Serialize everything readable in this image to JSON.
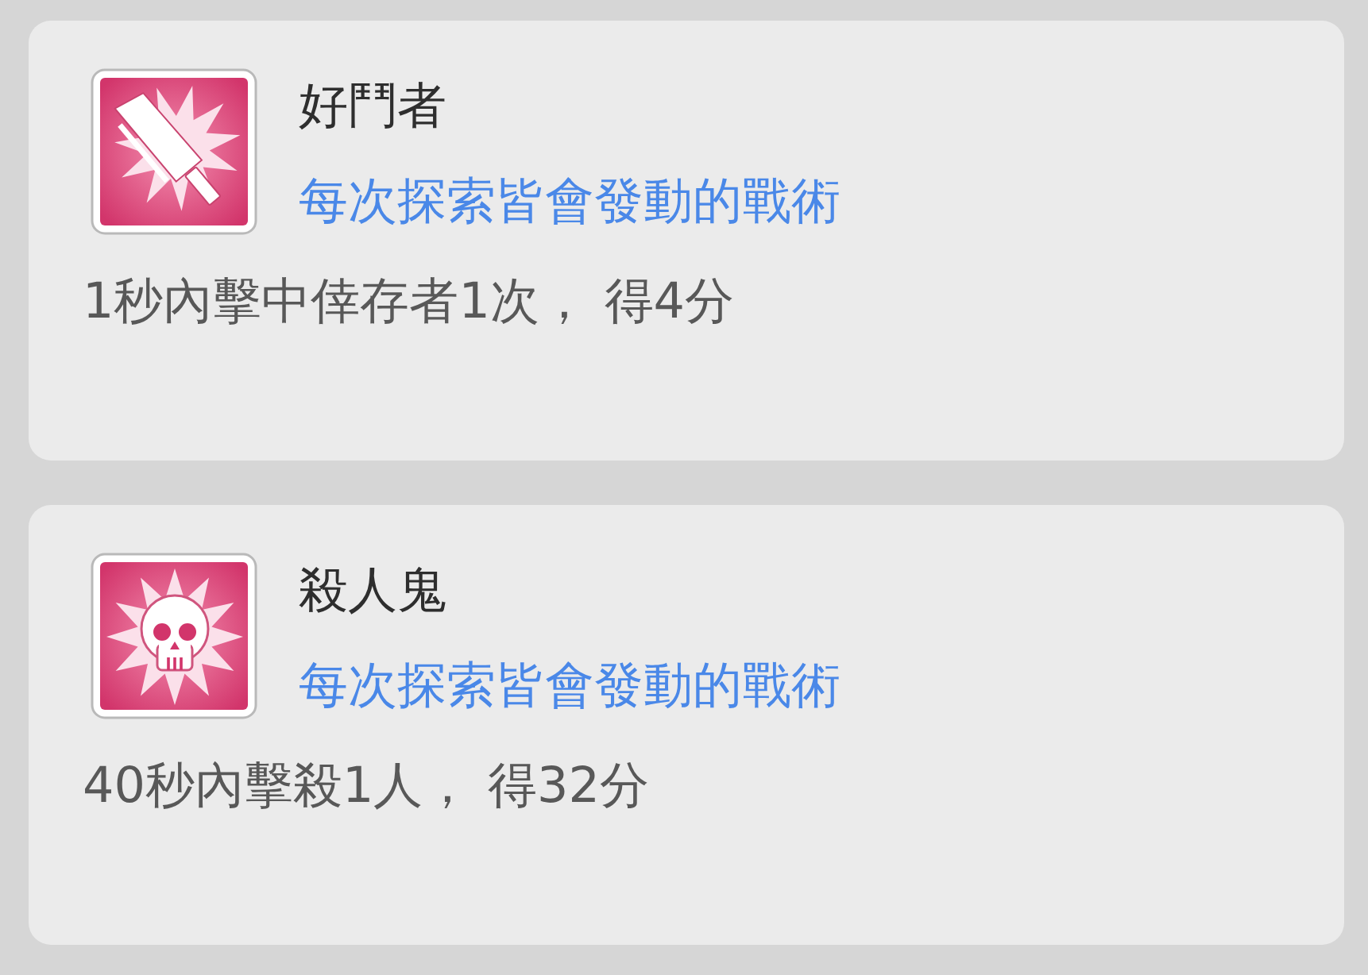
{
  "cards": [
    {
      "title": "好鬥者",
      "subtitle": "每次探索皆會發動的戰術",
      "description": "1秒內擊中倖存者1次， 得4分"
    },
    {
      "title": "殺人鬼",
      "subtitle": "每次探索皆會發動的戰術",
      "description": "40秒內擊殺1人， 得32分"
    }
  ]
}
